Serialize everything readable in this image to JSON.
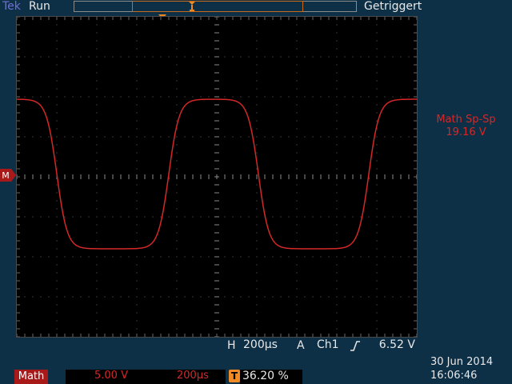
{
  "header": {
    "brand": "Tek",
    "run_state": "Run",
    "trigger_state": "Getriggert"
  },
  "markers": {
    "trigger_position": "T",
    "math_ref": "M"
  },
  "measurement": {
    "title": "Math Sp-Sp",
    "value": "19.16 V"
  },
  "horizontal": {
    "label": "H",
    "value": "200µs"
  },
  "trigger": {
    "source_label": "A",
    "channel": "Ch1",
    "slope_icon": "rising-edge-icon",
    "level": "6.52 V"
  },
  "math_channel": {
    "label": "Math",
    "scale": "5.00 V",
    "timebase": "200µs"
  },
  "trigger_offset": {
    "icon": "T",
    "value": "36.20 %"
  },
  "clock": {
    "date": "30 Jun  2014",
    "time": "16:06:46"
  },
  "colors": {
    "background": "#0e3046",
    "screen": "#000000",
    "trace": "#d42828",
    "trigger": "#f08a24",
    "brand": "#6f6fd8"
  },
  "waveform": {
    "type": "square-like, rounded edges",
    "cycles_visible": 2,
    "peak_to_peak_v": 19.16,
    "period_us": 1000
  }
}
